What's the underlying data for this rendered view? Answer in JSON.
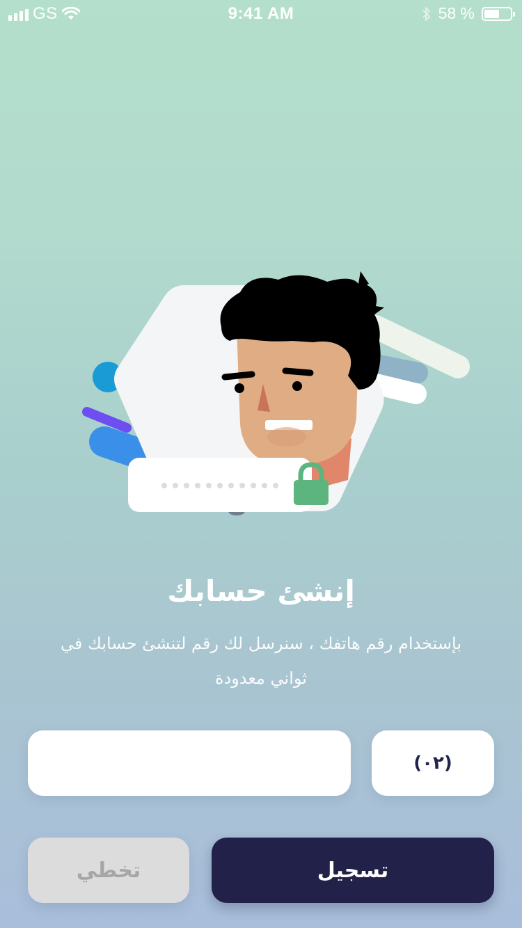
{
  "status_bar": {
    "carrier": "GS",
    "time": "9:41 AM",
    "battery_percent": "58 %",
    "battery_level": 0.58,
    "icons": [
      "signal-icon",
      "wifi-icon",
      "bluetooth-icon",
      "battery-icon"
    ]
  },
  "illustration": {
    "icon": "user-lock-illustration",
    "password_mask": "●●●●●●●●●●●"
  },
  "title": "إنشئ حسابك",
  "description": "بإستخدام رقم هاتفك ، سنرسل لك رقم لتنشئ حسابك في ثواني معدودة",
  "phone": {
    "value": "",
    "placeholder": "",
    "country_code": "(٠٢)"
  },
  "buttons": {
    "register_label": "تسجيل",
    "skip_label": "تخطي"
  },
  "colors": {
    "primary": "#22214a",
    "skip_bg": "#dcdcdc",
    "skip_text": "#a6a6a6",
    "lock_green": "#5cb57e"
  }
}
